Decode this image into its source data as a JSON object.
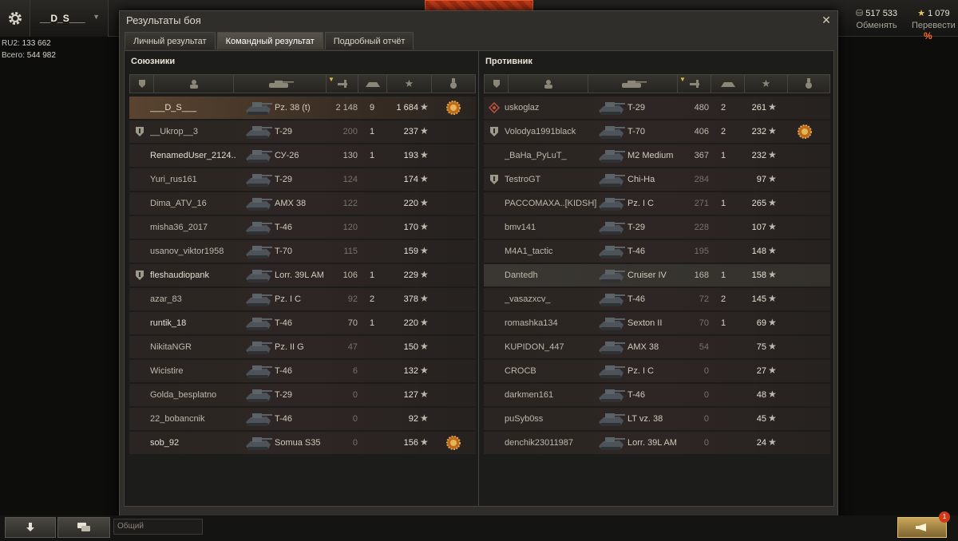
{
  "topbar": {
    "player_name": "__D_S___",
    "stats": [
      {
        "label": "RU2:",
        "value": "133 662"
      },
      {
        "label": "Всего:",
        "value": "544 982"
      }
    ],
    "credits": {
      "value": "517 533",
      "label": "Обменять"
    },
    "gold": {
      "value": "1 079",
      "label": "Перевести",
      "badge": "%"
    }
  },
  "dialog": {
    "title": "Результаты боя",
    "tabs": [
      "Личный результат",
      "Командный результат",
      "Подробный отчёт"
    ],
    "active_tab": 1
  },
  "allies": {
    "title": "Союзники",
    "rows": [
      {
        "name": "___D_S___",
        "tank": "Pz. 38 (t)",
        "damage": "2 148",
        "kills": "9",
        "xp": "1 684",
        "platoon": false,
        "medal": true,
        "self": true
      },
      {
        "name": "__Ukrop__3",
        "tank": "T-29",
        "damage": "200",
        "kills": "1",
        "xp": "237",
        "platoon": true,
        "medal": false
      },
      {
        "name": "RenamedUser_2124..",
        "tank": "СУ-26",
        "damage": "130",
        "kills": "1",
        "xp": "193",
        "platoon": false,
        "medal": false,
        "bright": true
      },
      {
        "name": "Yuri_rus161",
        "tank": "T-29",
        "damage": "124",
        "kills": "",
        "xp": "174",
        "platoon": false,
        "medal": false
      },
      {
        "name": "Dima_ATV_16",
        "tank": "AMX 38",
        "damage": "122",
        "kills": "",
        "xp": "220",
        "platoon": false,
        "medal": false
      },
      {
        "name": "misha36_2017",
        "tank": "T-46",
        "damage": "120",
        "kills": "",
        "xp": "170",
        "platoon": false,
        "medal": false
      },
      {
        "name": "usanov_viktor1958",
        "tank": "T-70",
        "damage": "115",
        "kills": "",
        "xp": "159",
        "platoon": false,
        "medal": false
      },
      {
        "name": "fleshaudiopank",
        "tank": "Lorr. 39L AM",
        "damage": "106",
        "kills": "1",
        "xp": "229",
        "platoon": true,
        "medal": false,
        "bright": true
      },
      {
        "name": "azar_83",
        "tank": "Pz. I C",
        "damage": "92",
        "kills": "2",
        "xp": "378",
        "platoon": false,
        "medal": false
      },
      {
        "name": "runtik_18",
        "tank": "T-46",
        "damage": "70",
        "kills": "1",
        "xp": "220",
        "platoon": false,
        "medal": false,
        "bright": true
      },
      {
        "name": "NikitaNGR",
        "tank": "Pz. II G",
        "damage": "47",
        "kills": "",
        "xp": "150",
        "platoon": false,
        "medal": false
      },
      {
        "name": "Wicistire",
        "tank": "T-46",
        "damage": "6",
        "kills": "",
        "xp": "132",
        "platoon": false,
        "medal": false
      },
      {
        "name": "Golda_besplatno",
        "tank": "T-29",
        "damage": "0",
        "kills": "",
        "xp": "127",
        "platoon": false,
        "medal": false
      },
      {
        "name": "22_bobancnik",
        "tank": "T-46",
        "damage": "0",
        "kills": "",
        "xp": "92",
        "platoon": false,
        "medal": false
      },
      {
        "name": "sob_92",
        "tank": "Somua S35",
        "damage": "0",
        "kills": "",
        "xp": "156",
        "platoon": false,
        "medal": true,
        "bright": true
      }
    ]
  },
  "enemies": {
    "title": "Противник",
    "rows": [
      {
        "name": "uskoglaz",
        "tank": "T-29",
        "damage": "480",
        "kills": "2",
        "xp": "261",
        "platoon": "diamond",
        "medal": false
      },
      {
        "name": "Volodya1991black",
        "tank": "T-70",
        "damage": "406",
        "kills": "2",
        "xp": "232",
        "platoon": true,
        "medal": true
      },
      {
        "name": "_BaHa_PyLuT_",
        "tank": "M2 Medium",
        "damage": "367",
        "kills": "1",
        "xp": "232",
        "platoon": false,
        "medal": false
      },
      {
        "name": "TestroGT",
        "tank": "Chi-Ha",
        "damage": "284",
        "kills": "",
        "xp": "97",
        "platoon": true,
        "medal": false
      },
      {
        "name": "PACCOMAXA..[KIDSH]",
        "tank": "Pz. I C",
        "damage": "271",
        "kills": "1",
        "xp": "265",
        "platoon": false,
        "medal": false
      },
      {
        "name": "bmv141",
        "tank": "T-29",
        "damage": "228",
        "kills": "",
        "xp": "107",
        "platoon": false,
        "medal": false
      },
      {
        "name": "M4A1_tactic",
        "tank": "T-46",
        "damage": "195",
        "kills": "",
        "xp": "148",
        "platoon": false,
        "medal": false
      },
      {
        "name": "Dantedh",
        "tank": "Cruiser IV",
        "damage": "168",
        "kills": "1",
        "xp": "158",
        "platoon": false,
        "medal": false,
        "hl": true
      },
      {
        "name": "_vasazxcv_",
        "tank": "T-46",
        "damage": "72",
        "kills": "2",
        "xp": "145",
        "platoon": false,
        "medal": false
      },
      {
        "name": "romashka134",
        "tank": "Sexton II",
        "damage": "70",
        "kills": "1",
        "xp": "69",
        "platoon": false,
        "medal": false
      },
      {
        "name": "KUPIDON_447",
        "tank": "AMX 38",
        "damage": "54",
        "kills": "",
        "xp": "75",
        "platoon": false,
        "medal": false
      },
      {
        "name": "CROCB",
        "tank": "Pz. I C",
        "damage": "0",
        "kills": "",
        "xp": "27",
        "platoon": false,
        "medal": false
      },
      {
        "name": "darkmen161",
        "tank": "T-46",
        "damage": "0",
        "kills": "",
        "xp": "48",
        "platoon": false,
        "medal": false
      },
      {
        "name": "puSyb0ss",
        "tank": "LT vz. 38",
        "damage": "0",
        "kills": "",
        "xp": "45",
        "platoon": false,
        "medal": false
      },
      {
        "name": "denchik23011987",
        "tank": "Lorr. 39L AM",
        "damage": "0",
        "kills": "",
        "xp": "24",
        "platoon": false,
        "medal": false
      }
    ]
  },
  "chat": {
    "placeholder": "Общий",
    "notifications": "1"
  }
}
